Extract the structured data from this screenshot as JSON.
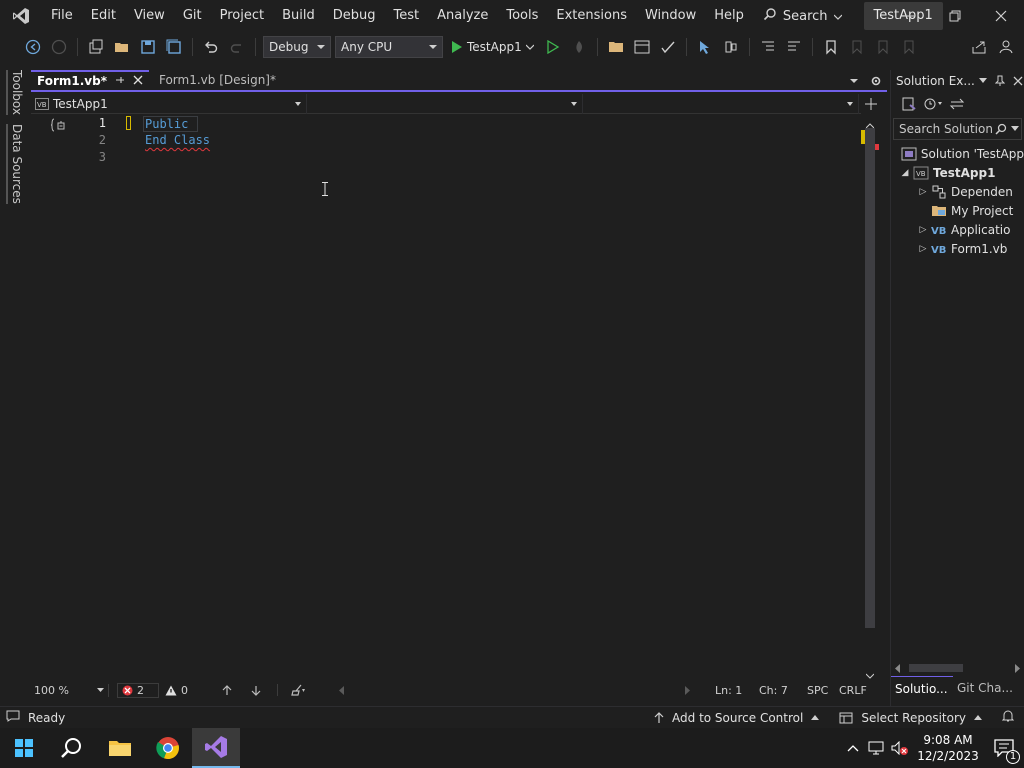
{
  "menu": {
    "items": [
      "File",
      "Edit",
      "View",
      "Git",
      "Project",
      "Build",
      "Debug",
      "Test",
      "Analyze",
      "Tools",
      "Extensions",
      "Window",
      "Help"
    ],
    "search_label": "Search",
    "title": "TestApp1"
  },
  "toolbar": {
    "config": "Debug",
    "platform": "Any CPU",
    "run_target": "TestApp1"
  },
  "leftstrip": {
    "toolbox": "Toolbox",
    "data_sources": "Data Sources"
  },
  "tabs": [
    {
      "label": "Form1.vb*"
    },
    {
      "label": "Form1.vb [Design]*"
    }
  ],
  "navbar": {
    "project": "TestApp1",
    "type": "",
    "member": ""
  },
  "editor": {
    "lines": [
      {
        "number": "1",
        "text": "Public "
      },
      {
        "number": "2",
        "text": "End Class"
      },
      {
        "number": "3",
        "text": ""
      }
    ]
  },
  "editor_status": {
    "zoom": "100 %",
    "errors": "2",
    "warnings": "0",
    "ln": "Ln: 1",
    "ch": "Ch: 7",
    "spc": "SPC",
    "eol": "CRLF"
  },
  "solution_explorer": {
    "title": "Solution Ex...",
    "search_placeholder": "Search Solution",
    "items": [
      {
        "label": "Solution 'TestApp"
      },
      {
        "label": "TestApp1"
      },
      {
        "label": "Dependen"
      },
      {
        "label": "My Project"
      },
      {
        "label": "Applicatio"
      },
      {
        "label": "Form1.vb"
      }
    ],
    "bottom_tabs": [
      "Solutio...",
      "Git Cha..."
    ]
  },
  "status": {
    "text": "Ready",
    "source_control": "Add to Source Control",
    "repository": "Select Repository"
  },
  "taskbar": {
    "time": "9:08 AM",
    "date": "12/2/2023",
    "notification_count": "1"
  },
  "colors": {
    "accent": "#7160e8",
    "keyword": "#569cd6",
    "error": "#e0383e"
  }
}
